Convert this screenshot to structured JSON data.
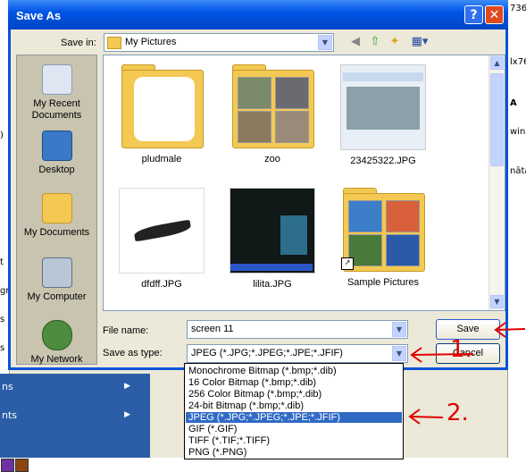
{
  "dialog": {
    "title": "Save As",
    "help_glyph": "?",
    "close_glyph": "✕",
    "save_in_label": "Save in:",
    "save_in_value": "My Pictures",
    "file_name_label": "File name:",
    "file_name_value": "screen 11",
    "save_as_type_label": "Save as type:",
    "save_as_type_value": "JPEG (*.JPG;*.JPEG;*.JPE;*.JFIF)",
    "save_button": "Save",
    "cancel_button": "Cancel"
  },
  "places": [
    {
      "label": "My Recent Documents",
      "icon": "recent-documents-icon"
    },
    {
      "label": "Desktop",
      "icon": "desktop-icon"
    },
    {
      "label": "My Documents",
      "icon": "my-documents-icon"
    },
    {
      "label": "My Computer",
      "icon": "my-computer-icon"
    },
    {
      "label": "My Network",
      "icon": "my-network-icon"
    }
  ],
  "files": [
    {
      "name": "pludmale",
      "kind": "folder"
    },
    {
      "name": "zoo",
      "kind": "folder"
    },
    {
      "name": "23425322.JPG",
      "kind": "image"
    },
    {
      "name": "dfdff.JPG",
      "kind": "image"
    },
    {
      "name": "lilita.JPG",
      "kind": "image"
    },
    {
      "name": "Sample Pictures",
      "kind": "folder-shortcut"
    }
  ],
  "type_options": [
    "Monochrome Bitmap (*.bmp;*.dib)",
    "16 Color Bitmap (*.bmp;*.dib)",
    "256 Color Bitmap (*.bmp;*.dib)",
    "24-bit Bitmap (*.bmp;*.dib)",
    "JPEG (*.JPG;*.JPEG;*.JPE;*.JFIF)",
    "GIF (*.GIF)",
    "TIFF (*.TIF;*.TIFF)",
    "PNG (*.PNG)"
  ],
  "background": {
    "right_fragments": [
      "736",
      "lx76",
      "A",
      "win",
      "nāta"
    ],
    "left_fragments": [
      ")",
      "t",
      "gr",
      "s",
      "s"
    ],
    "start_items": [
      "ns",
      "nts"
    ]
  },
  "annotations": {
    "one": "1.",
    "two": "2."
  },
  "colors": {
    "titlebar": "#0055e5",
    "selection": "#316ac5",
    "annotation": "#e00000"
  }
}
